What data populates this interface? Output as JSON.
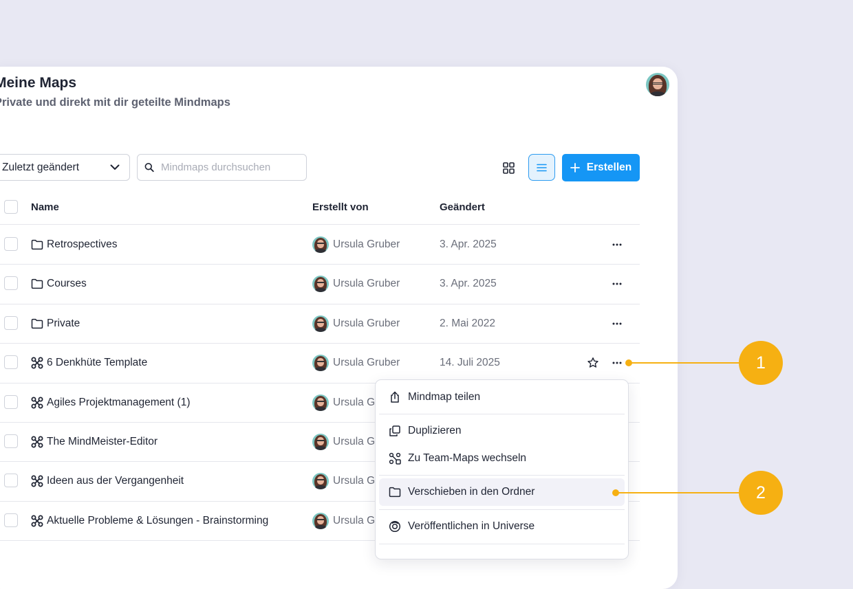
{
  "header": {
    "title": "Meine Maps",
    "subtitle": "Private und direkt mit dir geteilte Mindmaps"
  },
  "toolbar": {
    "sort_value": "Zuletzt geändert",
    "search_placeholder": "Mindmaps durchsuchen",
    "create_label": "Erstellen"
  },
  "table": {
    "headers": {
      "name": "Name",
      "created_by": "Erstellt von",
      "changed": "Geändert"
    },
    "rows": [
      {
        "type": "folder",
        "name": "Retrospectives",
        "creator": "Ursula Gruber",
        "changed": "3. Apr. 2025"
      },
      {
        "type": "folder",
        "name": "Courses",
        "creator": "Ursula Gruber",
        "changed": "3. Apr. 2025"
      },
      {
        "type": "folder",
        "name": "Private",
        "creator": "Ursula Gruber",
        "changed": "2. Mai 2022"
      },
      {
        "type": "map",
        "name": "6 Denkhüte Template",
        "creator": "Ursula Gruber",
        "changed": "14. Juli 2025"
      },
      {
        "type": "map",
        "name": "Agiles Projektmanagement (1)",
        "creator": "Ursula Gr",
        "changed": ""
      },
      {
        "type": "map",
        "name": "The MindMeister-Editor",
        "creator": "Ursula Gr",
        "changed": ""
      },
      {
        "type": "map",
        "name": "Ideen aus der Vergangenheit",
        "creator": "Ursula Gr",
        "changed": ""
      },
      {
        "type": "map",
        "name": "Aktuelle Probleme & Lösungen - Brainstorming",
        "creator": "Ursula Gr",
        "changed": ""
      }
    ]
  },
  "context_menu": {
    "items": [
      {
        "label": "Mindmap teilen",
        "icon": "share-icon"
      },
      {
        "label": "Duplizieren",
        "icon": "duplicate-icon"
      },
      {
        "label": "Zu Team-Maps wechseln",
        "icon": "team-maps-icon"
      },
      {
        "label": "Verschieben in den Ordner",
        "icon": "folder-icon"
      },
      {
        "label": "Veröffentlichen in Universe",
        "icon": "universe-icon"
      }
    ]
  },
  "callouts": [
    "1",
    "2"
  ],
  "colors": {
    "accent": "#1596f5",
    "callout": "#f6b012",
    "background": "#e8e8f3"
  }
}
